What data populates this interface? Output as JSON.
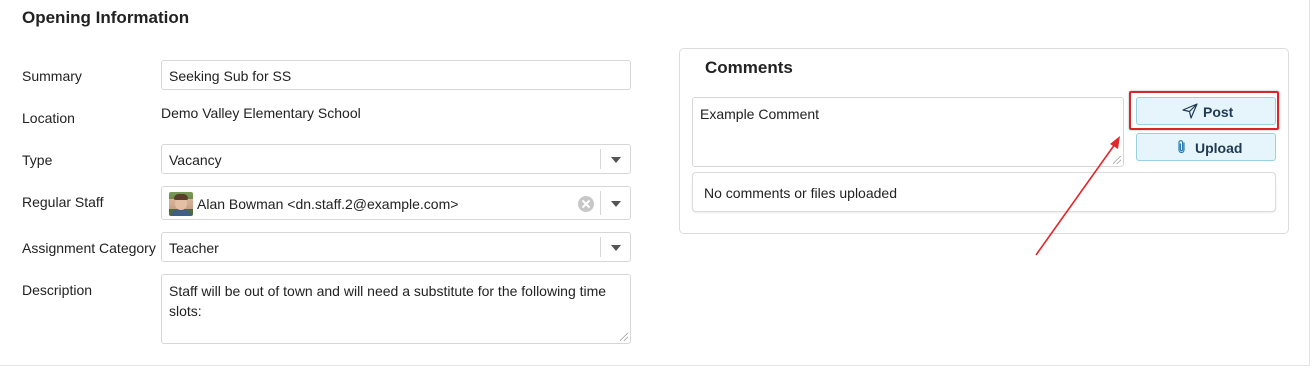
{
  "section": {
    "title": "Opening Information"
  },
  "form": {
    "summary": {
      "label": "Summary",
      "value": "Seeking Sub for SS"
    },
    "location": {
      "label": "Location",
      "value": "Demo Valley Elementary School"
    },
    "type": {
      "label": "Type",
      "value": "Vacancy"
    },
    "regular_staff": {
      "label": "Regular Staff",
      "value": "Alan Bowman <dn.staff.2@example.com>"
    },
    "assignment_category": {
      "label": "Assignment Category",
      "value": "Teacher"
    },
    "description": {
      "label": "Description",
      "value": "Staff will be out of town and will need a substitute for the following time slots:"
    }
  },
  "comments": {
    "title": "Comments",
    "input_value": "Example Comment",
    "post_label": "Post",
    "upload_label": "Upload",
    "empty_message": "No comments or files uploaded"
  },
  "icons": {
    "post": "send-icon",
    "upload": "paperclip-icon",
    "dropdown": "chevron-down-icon",
    "clear": "clear-icon"
  },
  "colors": {
    "button_bg": "#e6f5fb",
    "button_border": "#9ad0e6",
    "highlight": "#d9262b",
    "annotation_arrow": "#e0282d"
  }
}
